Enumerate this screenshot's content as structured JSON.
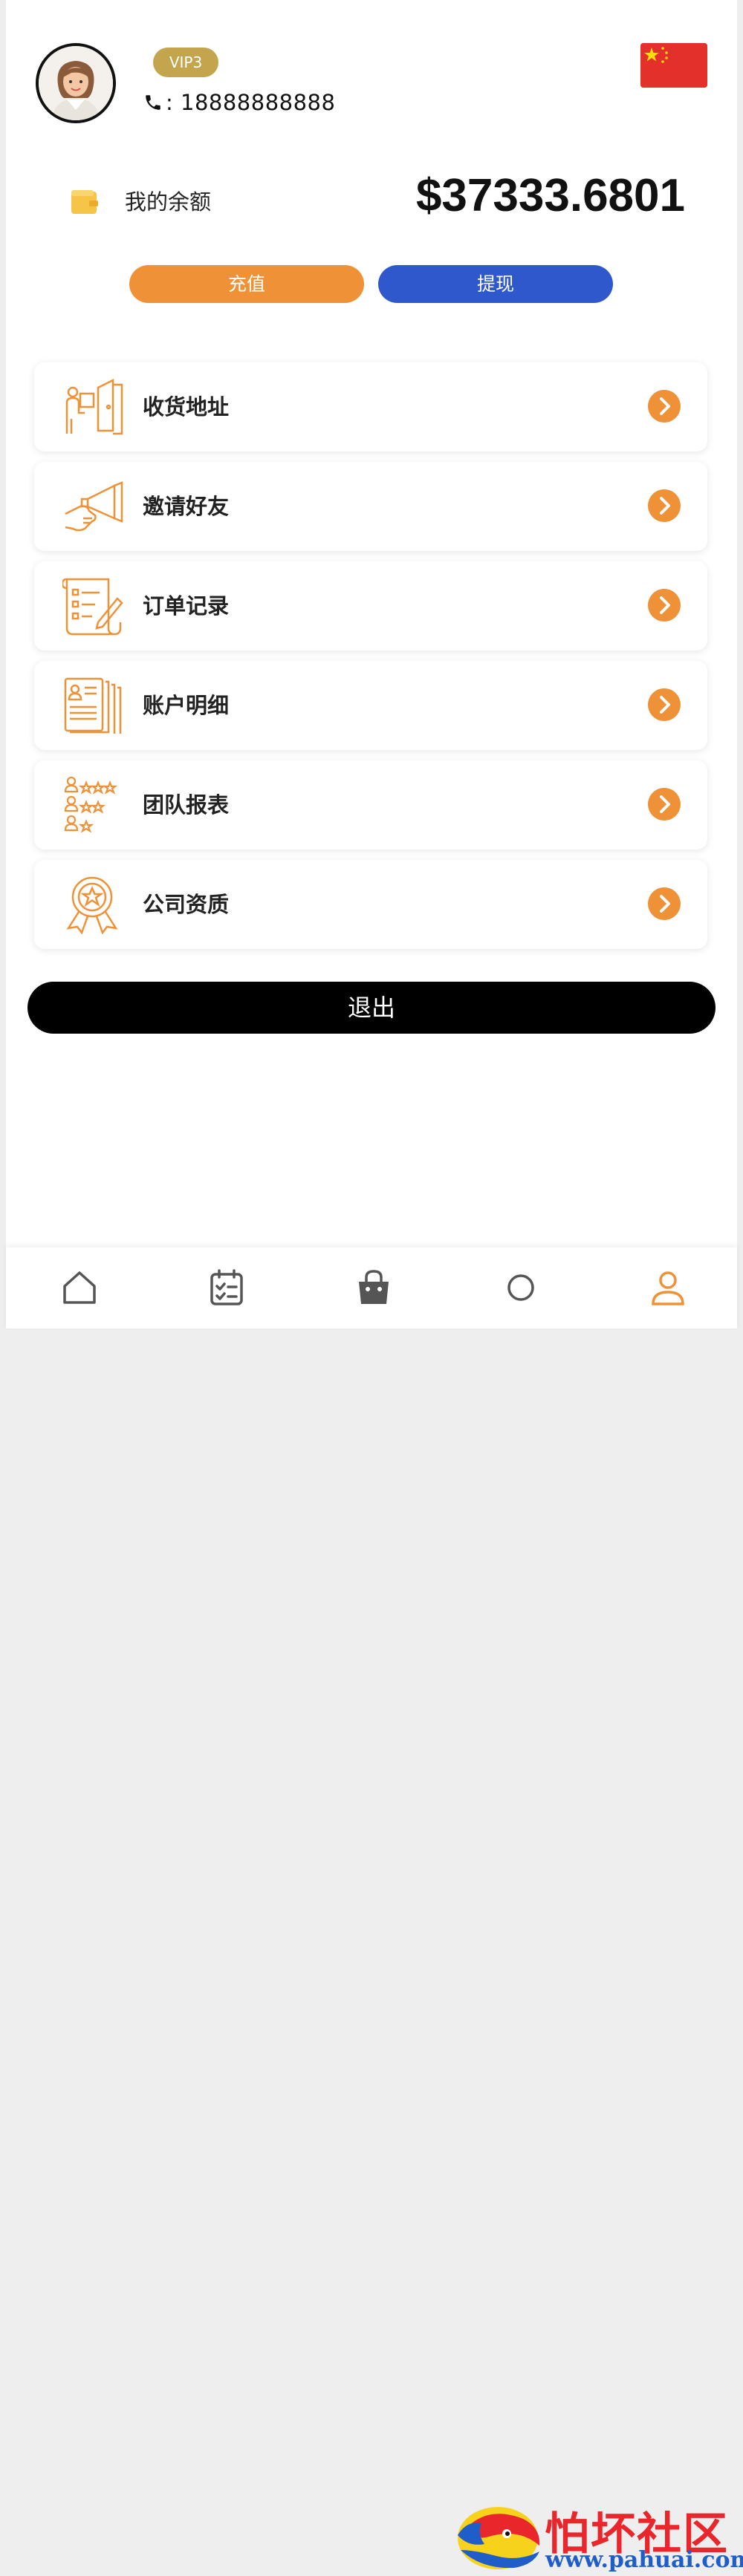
{
  "profile": {
    "vip_badge": "VIP3",
    "phone_prefix": ": ",
    "phone": "18888888888"
  },
  "balance": {
    "label": "我的余额",
    "amount": "$37333.6801"
  },
  "actions": {
    "recharge": "充值",
    "withdraw": "提现"
  },
  "menu": [
    {
      "label": "收货地址",
      "icon": "delivery-address-icon"
    },
    {
      "label": "邀请好友",
      "icon": "invite-megaphone-icon"
    },
    {
      "label": "订单记录",
      "icon": "order-record-icon"
    },
    {
      "label": "账户明细",
      "icon": "account-details-icon"
    },
    {
      "label": "团队报表",
      "icon": "team-report-icon"
    },
    {
      "label": "公司资质",
      "icon": "company-certificate-icon"
    }
  ],
  "logout": "退出",
  "bottom_nav": [
    "home-icon",
    "tasks-icon",
    "shop-bag-icon",
    "service-icon",
    "profile-icon"
  ],
  "watermark": {
    "title": "怕坏社区",
    "url": "www.pahuai.com"
  },
  "colors": {
    "accent_orange": "#ef9136",
    "accent_blue": "#2f58cc",
    "vip_gold": "#c3a54d",
    "logout_black": "#000000"
  }
}
